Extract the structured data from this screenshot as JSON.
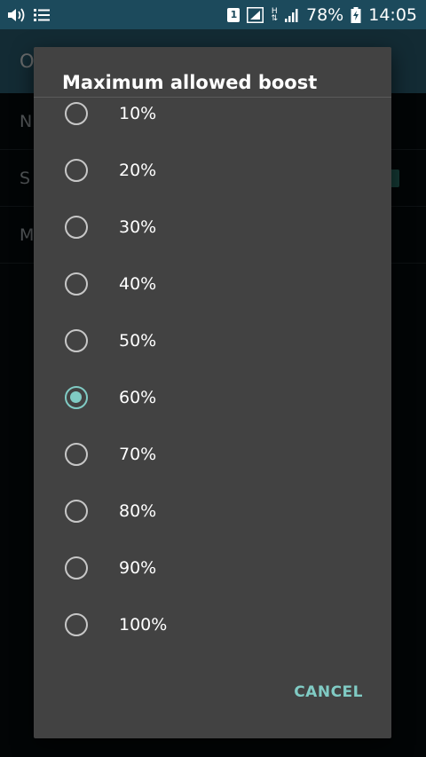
{
  "status_bar": {
    "sim_label": "1",
    "network_label": "H",
    "battery": "78%",
    "time": "14:05",
    "icons": [
      "volume-icon",
      "list-icon",
      "sim-icon",
      "signal-box-icon",
      "hspa-icon",
      "signal-icon",
      "battery-charging-icon"
    ]
  },
  "background": {
    "app_bar_title": "O",
    "rows": [
      {
        "label": "N"
      },
      {
        "label": "S"
      },
      {
        "label": "M"
      }
    ]
  },
  "dialog": {
    "title": "Maximum allowed boost",
    "options": [
      {
        "label": "10%",
        "selected": false
      },
      {
        "label": "20%",
        "selected": false
      },
      {
        "label": "30%",
        "selected": false
      },
      {
        "label": "40%",
        "selected": false
      },
      {
        "label": "50%",
        "selected": false
      },
      {
        "label": "60%",
        "selected": true
      },
      {
        "label": "70%",
        "selected": false
      },
      {
        "label": "80%",
        "selected": false
      },
      {
        "label": "90%",
        "selected": false
      },
      {
        "label": "100%",
        "selected": false
      }
    ],
    "cancel_label": "CANCEL"
  },
  "colors": {
    "accent": "#80cbc4",
    "dialog_bg": "#424242",
    "status_bar": "#1c4a5c"
  }
}
